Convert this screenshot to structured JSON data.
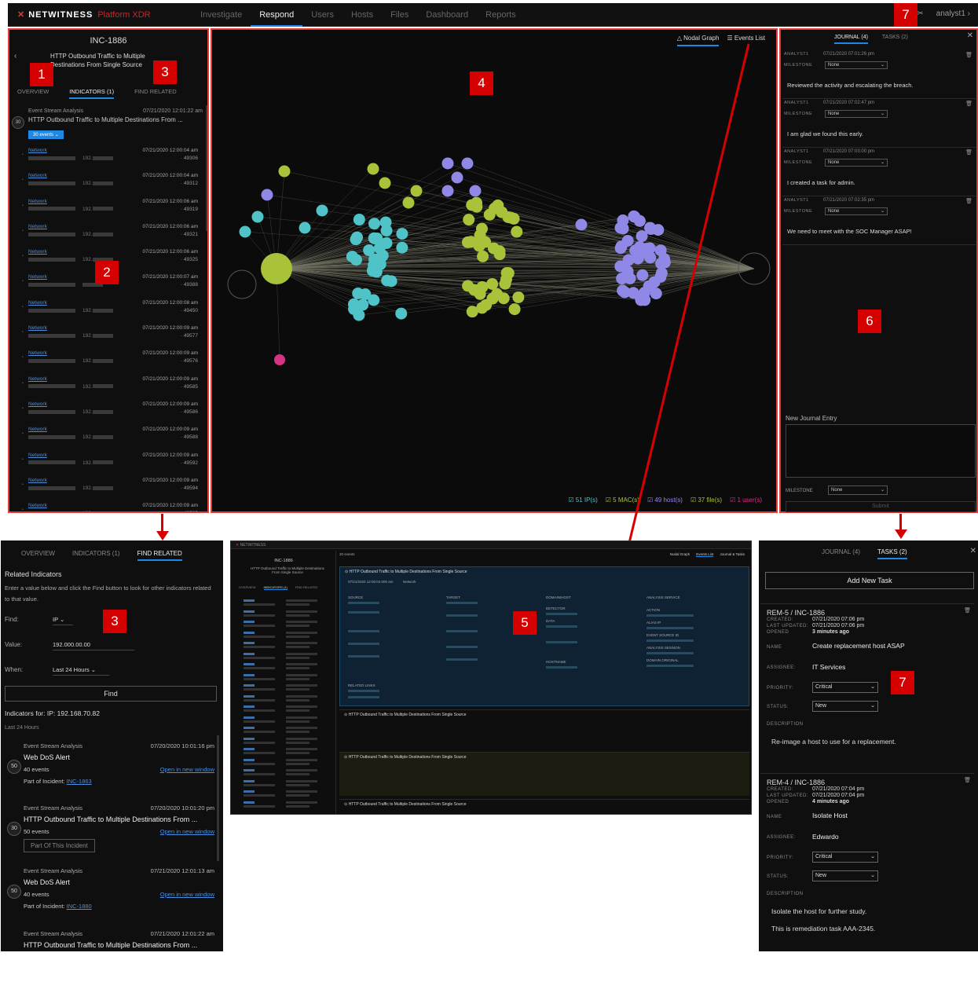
{
  "topbar": {
    "brand": "NETWITNESS",
    "platform": "Platform XDR",
    "nav": [
      "Investigate",
      "Respond",
      "Users",
      "Hosts",
      "Files",
      "Dashboard",
      "Reports"
    ],
    "user": "analyst1"
  },
  "callouts": {
    "n1": "1",
    "n2": "2",
    "n3": "3",
    "n4": "4",
    "n5": "5",
    "n6": "6",
    "n7": "7"
  },
  "incident": {
    "id": "INC-1886",
    "title": "HTTP Outbound Traffic to Multiple Destinations From Single Source",
    "tabs": [
      "OVERVIEW",
      "INDICATORS (1)",
      "FIND RELATED"
    ],
    "indicator": {
      "source": "Event Stream Analysis",
      "date": "07/21/2020 12:01:22 am",
      "name": "HTTP Outbound Traffic to Multiple Destinations From ...",
      "count": "30",
      "events_btn": "30 events"
    },
    "events": [
      {
        "type": "Network",
        "date": "07/21/2020 12:00:04 am",
        "ip": "192.",
        "port": "· 49306"
      },
      {
        "type": "Network",
        "date": "07/21/2020 12:00:04 am",
        "ip": "192.",
        "port": "· 49312"
      },
      {
        "type": "Network",
        "date": "07/21/2020 12:00:06 am",
        "ip": "192.",
        "port": "· 49319"
      },
      {
        "type": "Network",
        "date": "07/21/2020 12:00:06 am",
        "ip": "192.",
        "port": "· 49321"
      },
      {
        "type": "Network",
        "date": "07/21/2020 12:00:06 am",
        "ip": "192.",
        "port": "· 49325"
      },
      {
        "type": "Network",
        "date": "07/21/2020 12:00:07 am",
        "ip": "",
        "port": "· 49388"
      },
      {
        "type": "Network",
        "date": "07/21/2020 12:00:08 am",
        "ip": "192.",
        "port": "· 49450"
      },
      {
        "type": "Network",
        "date": "07/21/2020 12:00:09 am",
        "ip": "192.",
        "port": "· 49577"
      },
      {
        "type": "Network",
        "date": "07/21/2020 12:00:09 am",
        "ip": "192.",
        "port": "· 49576"
      },
      {
        "type": "Network",
        "date": "07/21/2020 12:00:09 am",
        "ip": "192.",
        "port": "· 49585"
      },
      {
        "type": "Network",
        "date": "07/21/2020 12:00:09 am",
        "ip": "192.",
        "port": "· 49586"
      },
      {
        "type": "Network",
        "date": "07/21/2020 12:00:09 am",
        "ip": "192.",
        "port": "· 49588"
      },
      {
        "type": "Network",
        "date": "07/21/2020 12:00:09 am",
        "ip": "192.",
        "port": "· 49592"
      },
      {
        "type": "Network",
        "date": "07/21/2020 12:00:09 am",
        "ip": "192.",
        "port": "· 49594"
      },
      {
        "type": "Network",
        "date": "07/21/2020 12:00:09 am",
        "ip": "192.",
        "port": "· 49595"
      }
    ]
  },
  "graph": {
    "tabs": [
      "Nodal Graph",
      "Events List"
    ],
    "legend": [
      "51 IP(s)",
      "5 MAC(s)",
      "49 host(s)",
      "37 file(s)",
      "1 user(s)"
    ],
    "colors": {
      "ip": "#4fc3c7",
      "mac": "#a8c23a",
      "host": "#9088e6",
      "file": "#a8c23a",
      "user": "#d63384"
    }
  },
  "journal": {
    "tabs": [
      "JOURNAL (4)",
      "TASKS (2)"
    ],
    "entries": [
      {
        "author": "ANALYST1",
        "date": "07/21/2020 07:01:26 pm",
        "milestone_label": "MILESTONE",
        "milestone": "None",
        "text": "Reviewed the activity and escalating the breach."
      },
      {
        "author": "ANALYST1",
        "date": "07/21/2020 07:02:47 pm",
        "milestone_label": "MILESTONE",
        "milestone": "None",
        "text": "I am glad we found this early."
      },
      {
        "author": "ANALYST1",
        "date": "07/21/2020 07:03:00 pm",
        "milestone_label": "MILESTONE",
        "milestone": "None",
        "text": "I created a task for admin."
      },
      {
        "author": "ANALYST1",
        "date": "07/21/2020 07:02:35 pm",
        "milestone_label": "MILESTONE",
        "milestone": "None",
        "text": "We need to meet with the SOC Manager ASAP!"
      }
    ],
    "new_label": "New Journal Entry",
    "milestone_label": "MILESTONE",
    "milestone": "None",
    "submit": "Submit"
  },
  "find_related": {
    "tabs": [
      "OVERVIEW",
      "INDICATORS (1)",
      "FIND RELATED"
    ],
    "title": "Related Indicators",
    "desc": "Enter a value below and click the Find button to look for other indicators related to that value.",
    "find_label": "Find:",
    "find_value": "IP",
    "value_label": "Value:",
    "value": "192.000.00.00",
    "when_label": "When:",
    "when_value": "Last 24 Hours",
    "find_btn": "Find",
    "indicators_for": "Indicators for: IP: 192.168.70.82",
    "last24": "Last 24 Hours",
    "items": [
      {
        "source": "Event Stream Analysis",
        "date": "07/20/2020 10:01:16 pm",
        "name": "Web DoS Alert",
        "count": "50",
        "events": "40 events",
        "open": "Open in new window",
        "part_prefix": "Part of Incident:",
        "incident": "INC-1863"
      },
      {
        "source": "Event Stream Analysis",
        "date": "07/20/2020 10:01:20 pm",
        "name": "HTTP Outbound Traffic to Multiple Destinations From ...",
        "count": "30",
        "events": "50 events",
        "open": "Open in new window",
        "part_btn": "Part Of This Incident"
      },
      {
        "source": "Event Stream Analysis",
        "date": "07/21/2020 12:01:13 am",
        "name": "Web DoS Alert",
        "count": "50",
        "events": "40 events",
        "open": "Open in new window",
        "part_prefix": "Part of Incident:",
        "incident": "INC-1880"
      },
      {
        "source": "Event Stream Analysis",
        "date": "07/21/2020 12:01:22 am",
        "name": "HTTP Outbound Traffic to Multiple Destinations From ..."
      }
    ]
  },
  "events_view": {
    "incident": "INC-1886",
    "subtitle": "HTTP Outbound Traffic to Multiple Destinations From Single Source",
    "tabs": [
      "OVERVIEW",
      "INDICATORS (1)",
      "FIND RELATED"
    ],
    "graph_tabs": [
      "Nodal Graph",
      "Events List",
      "Journal & Tasks"
    ],
    "count": "30 events",
    "event_title": "HTTP Outbound Traffic to Multiple Destinations From Single Source",
    "event_time": "07/21/2020 12:00:04.000 am",
    "event_type": "Network",
    "cols": [
      "SOURCE",
      "TARGET",
      "DOMAIN/HOST",
      "ANALYSIS SERVICE"
    ],
    "fields": [
      "DETECTOR",
      "DATA",
      "ACTION",
      "ALIAS IP",
      "EVENT SOURCE ID",
      "ANALYSIS SESSION",
      "DOMAIN ORIGINAL",
      "HOSTNAME",
      "RELATED LINKS"
    ]
  },
  "tasks": {
    "tabs": [
      "JOURNAL (4)",
      "TASKS (2)"
    ],
    "add": "Add New Task",
    "items": [
      {
        "id": "REM-5 / INC-1886",
        "created": "07/21/2020 07:06 pm",
        "updated": "07/21/2020 07:06 pm",
        "opened": "3 minutes ago",
        "name": "Create replacement host ASAP",
        "assignee": "IT Services",
        "priority": "Critical",
        "status": "New",
        "description": "Re-image a host to use for a replacement.",
        "description2": ""
      },
      {
        "id": "REM-4 / INC-1886",
        "created": "07/21/2020 07:04 pm",
        "updated": "07/21/2020 07:04 pm",
        "opened": "4 minutes ago",
        "name": "Isolate Host",
        "assignee": "Edwardo",
        "priority": "Critical",
        "status": "New",
        "description": "Isolate the host for further study.",
        "description2": "This is remediation task AAA-2345."
      }
    ],
    "labels": {
      "created": "CREATED:",
      "updated": "LAST UPDATED:",
      "opened": "OPENED",
      "name": "NAME",
      "assignee": "ASSIGNEE:",
      "priority": "PRIORITY:",
      "status": "STATUS:",
      "description": "DESCRIPTION"
    }
  }
}
